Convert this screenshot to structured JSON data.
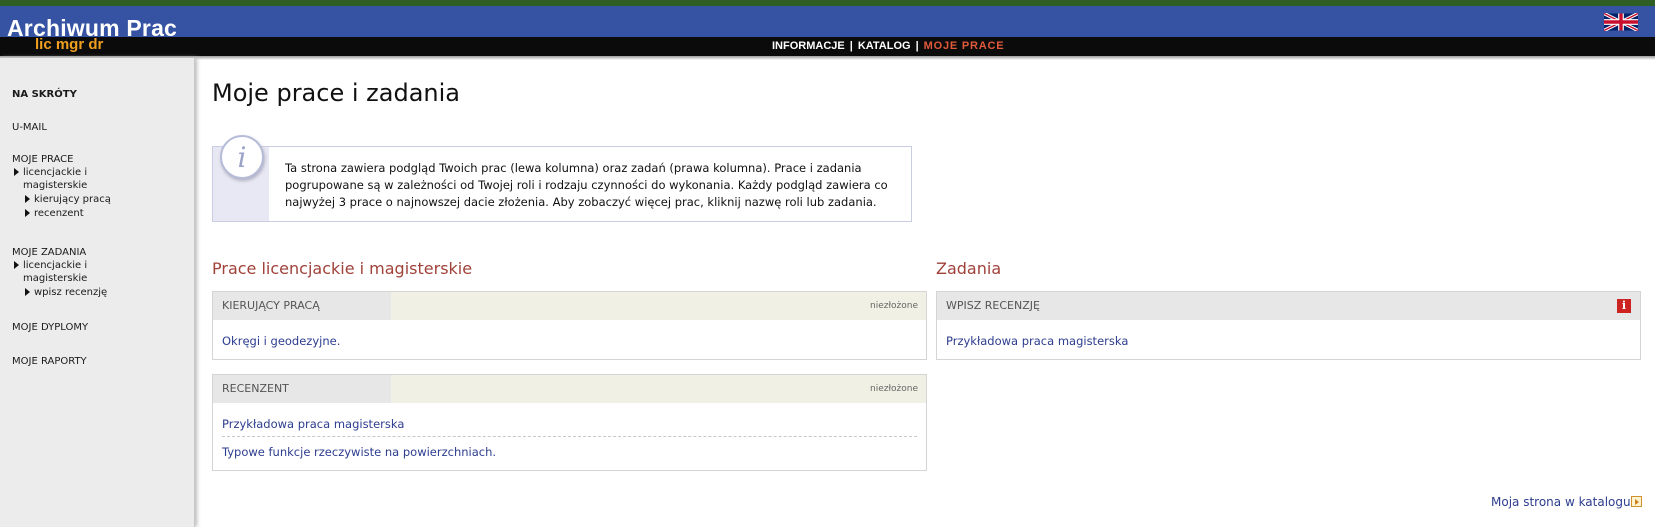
{
  "header": {
    "logo_title": "Archiwum Prac",
    "logo_subtitle": "lic mgr dr",
    "nav": [
      {
        "label": "INFORMACJE"
      },
      {
        "label": "KATALOG"
      },
      {
        "label": "MOJE PRACE"
      }
    ],
    "separator": "|",
    "language_icon": "uk-flag-icon"
  },
  "sidebar": {
    "shortcuts": "NA SKRÓTY",
    "umail": "U-MAIL",
    "my_works": {
      "label": "MOJE PRACE",
      "group": [
        "licencjackie i",
        "magisterskie"
      ],
      "items": [
        "kierujący pracą",
        "recenzent"
      ]
    },
    "my_tasks": {
      "label": "MOJE ZADANIA",
      "group": [
        "licencjackie i",
        "magisterskie"
      ],
      "items": [
        "wpisz recenzję"
      ]
    },
    "my_diplomas": "MOJE DYPLOMY",
    "my_reports": "MOJE RAPORTY"
  },
  "main": {
    "title": "Moje prace i zadania",
    "info_text": "Ta strona zawiera podgląd Twoich prac (lewa kolumna) oraz zadań (prawa kolumna). Prace i zadania pogrupowane są w zależności od Twojej roli i rodzaju czynności do wykonania. Każdy podgląd zawiera co najwyżej 3 prace o najnowszej dacie złożenia. Aby zobaczyć więcej prac, kliknij nazwę roli lub zadania.",
    "works_section": {
      "title": "Prace licencjackie i magisterskie",
      "panels": [
        {
          "role": "KIERUJĄCY PRACĄ",
          "status": "niezłożone",
          "items": [
            "Okręgi i geodezyjne."
          ]
        },
        {
          "role": "RECENZENT",
          "status": "niezłożone",
          "items": [
            "Przykładowa praca magisterska",
            "Typowe funkcje rzeczywiste na powierzchniach."
          ]
        }
      ]
    },
    "tasks_section": {
      "title": "Zadania",
      "panels": [
        {
          "role": "WPISZ RECENZJĘ",
          "badge": "i",
          "items": [
            "Przykładowa praca magisterska"
          ]
        }
      ]
    },
    "catalog_link": "Moja strona w katalogu"
  },
  "colors": {
    "header_blue": "#3653a3",
    "accent_orange": "#f0a020",
    "active_nav": "#e05a3a",
    "section_title": "#a0413a",
    "link": "#2d3d8f"
  }
}
